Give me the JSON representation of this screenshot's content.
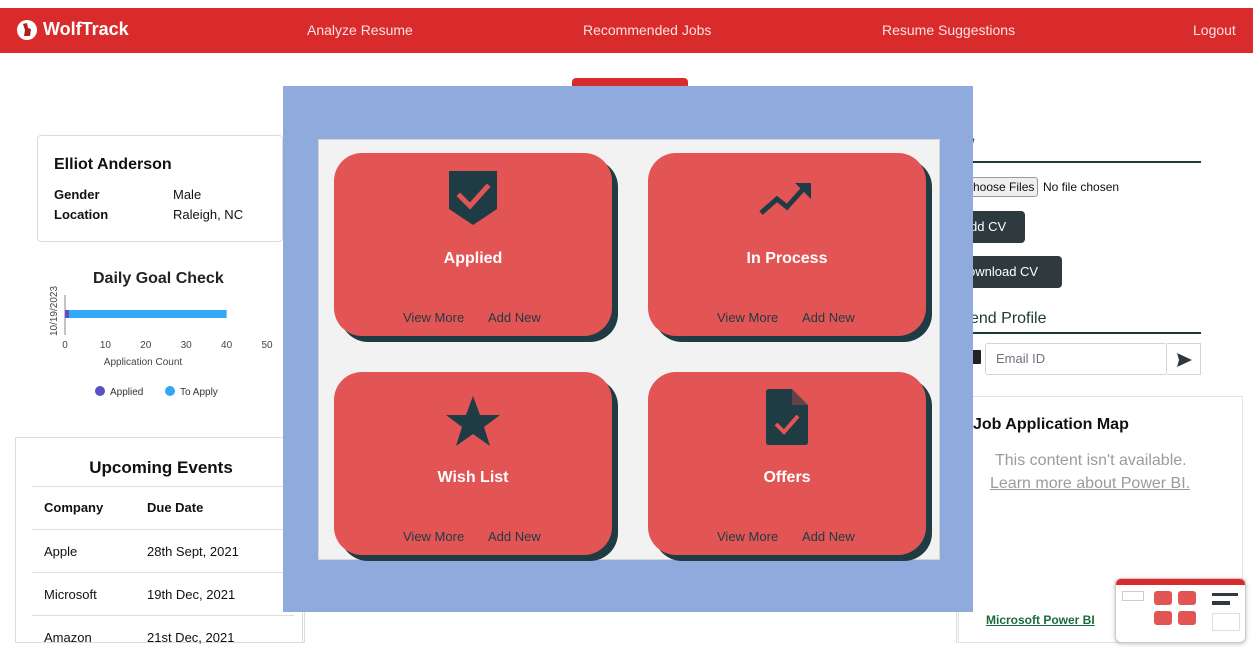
{
  "nav": {
    "brand": "WolfTrack",
    "links": [
      "Analyze Resume",
      "Recommended Jobs",
      "Resume Suggestions",
      "Logout"
    ]
  },
  "profile": {
    "name": "Elliot Anderson",
    "gender_label": "Gender",
    "gender": "Male",
    "location_label": "Location",
    "location": "Raleigh, NC"
  },
  "goal": {
    "title": "Daily Goal Check",
    "chart_data": {
      "type": "bar",
      "orientation": "horizontal",
      "stacked": true,
      "categories": [
        "10/19/2023"
      ],
      "series": [
        {
          "name": "Applied",
          "values": [
            1
          ],
          "color": "#5b4fc4"
        },
        {
          "name": "To Apply",
          "values": [
            39
          ],
          "color": "#2fa8f5"
        }
      ],
      "xticks": [
        "0",
        "10",
        "20",
        "30",
        "40",
        "50"
      ],
      "xlim": [
        0,
        50
      ],
      "xlabel": "Application Count",
      "legend": "bottom"
    }
  },
  "events": {
    "title": "Upcoming Events",
    "headers": [
      "Company",
      "Due Date"
    ],
    "rows": [
      [
        "Apple",
        "28th Sept, 2021"
      ],
      [
        "Microsoft",
        "19th Dec, 2021"
      ],
      [
        "Amazon",
        "21st Dec, 2021"
      ]
    ]
  },
  "right": {
    "cv_heading_fragment": "/",
    "choose_files": "hoose Files",
    "file_status": "No file chosen",
    "add_cv": "dd CV",
    "download_cv": "ownload CV",
    "send_profile": "end Profile",
    "email_placeholder": "Email ID",
    "map_title": "Job Application Map",
    "map_msg": "This content isn't available.",
    "map_link": "Learn more about Power BI.",
    "power_bi": "Microsoft Power BI"
  },
  "tiles": [
    {
      "label": "Applied",
      "icon": "check-shield-icon",
      "view": "View More",
      "add": "Add New"
    },
    {
      "label": "In Process",
      "icon": "trending-up-icon",
      "view": "View More",
      "add": "Add New"
    },
    {
      "label": "Wish List",
      "icon": "star-icon",
      "view": "View More",
      "add": "Add New"
    },
    {
      "label": "Offers",
      "icon": "document-check-icon",
      "view": "View More",
      "add": "Add New"
    }
  ],
  "colors": {
    "brand_red": "#d92b2b",
    "tile_red": "#e35454",
    "tile_shadow": "#1f3b44",
    "overlay": "#8faadc"
  }
}
